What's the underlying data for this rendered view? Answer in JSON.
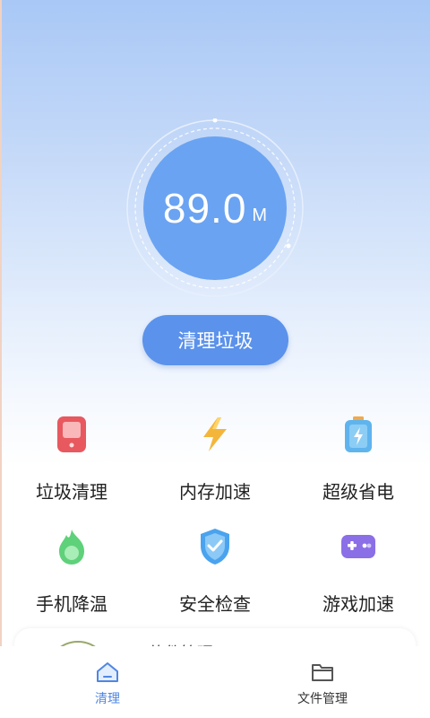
{
  "gauge": {
    "value": "89.0",
    "unit": "M"
  },
  "primary_button": {
    "label": "清理垃圾"
  },
  "features": [
    {
      "label": "垃圾清理",
      "icon": "phone-trash-icon"
    },
    {
      "label": "内存加速",
      "icon": "lightning-icon"
    },
    {
      "label": "超级省电",
      "icon": "battery-icon"
    },
    {
      "label": "手机降温",
      "icon": "flame-cool-icon"
    },
    {
      "label": "安全检查",
      "icon": "shield-icon"
    },
    {
      "label": "游戏加速",
      "icon": "gamepad-icon"
    }
  ],
  "card": {
    "title": "软件管理"
  },
  "nav": [
    {
      "label": "清理",
      "icon": "home-icon",
      "active": true
    },
    {
      "label": "文件管理",
      "icon": "folder-icon",
      "active": false
    }
  ],
  "colors": {
    "accent": "#5b92eb",
    "gauge": "#6aa3f2",
    "nav_active": "#4f86e3"
  }
}
